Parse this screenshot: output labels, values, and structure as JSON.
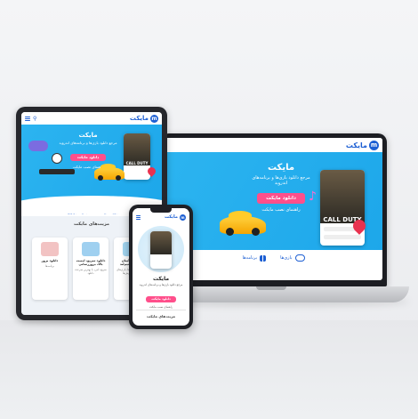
{
  "brand": {
    "name": "مایکت",
    "logo_letter": "m",
    "color": "#1d5fd3"
  },
  "hero": {
    "title": "مایکت",
    "subtitle": "مرجع دانلود بازی‌ها و برنامه‌های اندروید",
    "download_label": "دانلود مایکت",
    "install_guide_label": "راهنمای نصب مایکت",
    "game_title": "CALL DUTY",
    "bg_color": "#23aeee",
    "button_color": "#ff4f8b"
  },
  "laptop": {
    "tabs": [
      {
        "label": "بازی‌ها",
        "icon": "gamepad-icon"
      },
      {
        "label": "برنامه‌ها",
        "icon": "grid-icon"
      }
    ]
  },
  "tablet": {
    "header_search_icon": "search-icon",
    "tabs": [
      {
        "label": "بازی"
      },
      {
        "label": "برنامه"
      },
      {
        "label": "دسته‌بندی"
      },
      {
        "label": "برترین‌ها"
      }
    ],
    "features_title": "مزیت‌های مایکت",
    "features": [
      {
        "title": "دریافت آسان بازی‌های تیم‌لند",
        "desc": "آموزش‌ها، بازی‌ها، بازی‌های مهیج و فروش‌ها"
      },
      {
        "title": "دانلود سریع، امنیت بالا، بروزرسانی",
        "desc": "سریع، امن، با بهترین سرعت دانلود"
      },
      {
        "title": "دانلود بروز",
        "desc": "برنامه‌ها"
      }
    ]
  },
  "phone": {
    "features_title": "مزیت‌های مایکت"
  }
}
